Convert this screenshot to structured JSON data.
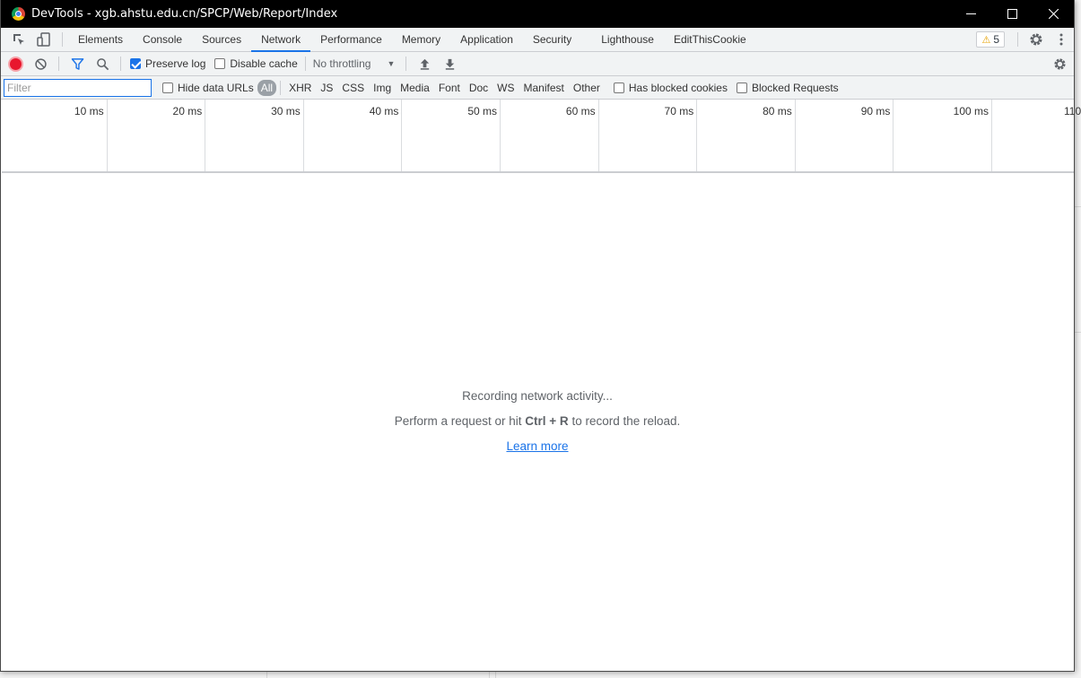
{
  "window": {
    "title": "DevTools - xgb.ahstu.edu.cn/SPCP/Web/Report/Index"
  },
  "tabs": [
    {
      "label": "Elements"
    },
    {
      "label": "Console"
    },
    {
      "label": "Sources"
    },
    {
      "label": "Network",
      "active": true
    },
    {
      "label": "Performance"
    },
    {
      "label": "Memory"
    },
    {
      "label": "Application"
    },
    {
      "label": "Security"
    },
    {
      "label": "Lighthouse"
    },
    {
      "label": "EditThisCookie"
    }
  ],
  "warnings": {
    "count": "5"
  },
  "toolbar": {
    "preserve_log": {
      "label": "Preserve log",
      "checked": true
    },
    "disable_cache": {
      "label": "Disable cache",
      "checked": false
    },
    "throttling": {
      "value": "No throttling"
    }
  },
  "filterbar": {
    "filter_placeholder": "Filter",
    "hide_data_urls": {
      "label": "Hide data URLs",
      "checked": false
    },
    "types": [
      "All",
      "XHR",
      "JS",
      "CSS",
      "Img",
      "Media",
      "Font",
      "Doc",
      "WS",
      "Manifest",
      "Other"
    ],
    "has_blocked_cookies": {
      "label": "Has blocked cookies",
      "checked": false
    },
    "blocked_requests": {
      "label": "Blocked Requests",
      "checked": false
    }
  },
  "timeline": {
    "ticks": [
      "10 ms",
      "20 ms",
      "30 ms",
      "40 ms",
      "50 ms",
      "60 ms",
      "70 ms",
      "80 ms",
      "90 ms",
      "100 ms",
      "110"
    ]
  },
  "empty_state": {
    "line1": "Recording network activity...",
    "line2_prefix": "Perform a request or hit ",
    "shortcut": "Ctrl + R",
    "line2_suffix": " to record the reload.",
    "learn_more": "Learn more"
  },
  "colors": {
    "accent": "#1a73e8",
    "record": "#e8172d",
    "titlebar": "#000000"
  }
}
